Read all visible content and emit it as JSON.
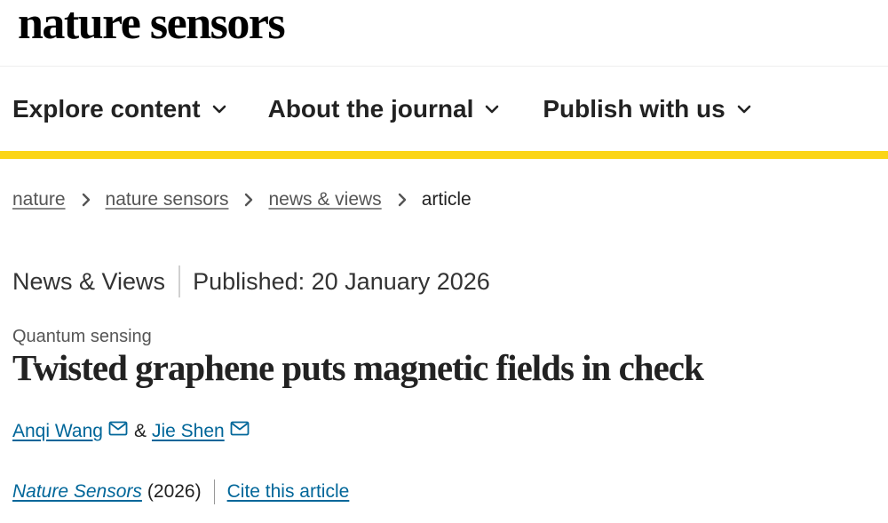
{
  "header": {
    "logo_text": "nature sensors"
  },
  "nav": {
    "items": [
      {
        "label": "Explore content",
        "icon": "chevron-down-icon"
      },
      {
        "label": "About the journal",
        "icon": "chevron-down-icon"
      },
      {
        "label": "Publish with us",
        "icon": "chevron-down-icon"
      }
    ]
  },
  "colors": {
    "accent_rule": "#fbd518",
    "link": "#006699",
    "text": "#222222"
  },
  "breadcrumb": {
    "items": [
      {
        "label": "nature",
        "link": true
      },
      {
        "label": "nature sensors",
        "link": true
      },
      {
        "label": "news & views",
        "link": true
      },
      {
        "label": "article",
        "link": false
      }
    ]
  },
  "article": {
    "type": "News & Views",
    "published": "Published: 20 January 2026",
    "subject": "Quantum sensing",
    "title": "Twisted graphene puts magnetic fields in check",
    "authors": [
      {
        "name": "Anqi Wang",
        "icon": "mail-icon"
      },
      {
        "name": "Jie Shen",
        "icon": "mail-icon"
      }
    ],
    "author_separator": "&",
    "journal": "Nature Sensors",
    "year": "(2026)",
    "cite_label": "Cite this article"
  }
}
